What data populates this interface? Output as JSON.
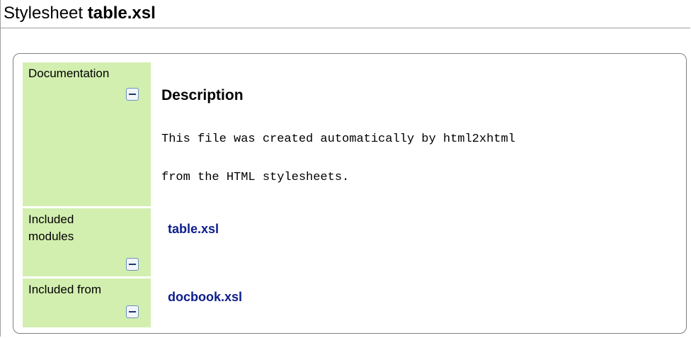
{
  "title": {
    "prefix": "Stylesheet",
    "name": "table.xsl"
  },
  "documentation": {
    "label": "Documentation",
    "heading": "Description",
    "lines": [
      "This file was created automatically by html2xhtml",
      "from the HTML stylesheets."
    ]
  },
  "included_modules": {
    "label": "Included modules",
    "items": [
      "table.xsl"
    ]
  },
  "included_from": {
    "label": "Included from",
    "items": [
      "docbook.xsl"
    ]
  },
  "icons": {
    "collapse": "collapse-icon"
  },
  "colors": {
    "label_background": "#d3efb0",
    "link": "#0c1d8c"
  }
}
